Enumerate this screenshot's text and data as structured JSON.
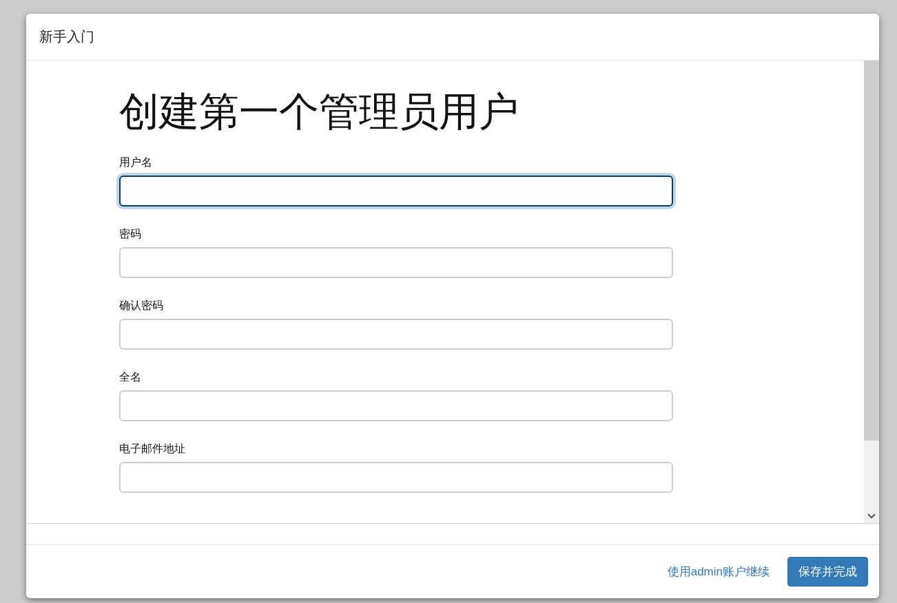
{
  "dialog": {
    "title": "新手入门"
  },
  "heading": "创建第一个管理员用户",
  "fields": [
    {
      "label": "用户名",
      "focused": true
    },
    {
      "label": "密码",
      "focused": false
    },
    {
      "label": "确认密码",
      "focused": false
    },
    {
      "label": "全名",
      "focused": false
    },
    {
      "label": "电子邮件地址",
      "focused": false
    }
  ],
  "footer": {
    "link": "使用admin账户继续",
    "button": "保存并完成"
  }
}
